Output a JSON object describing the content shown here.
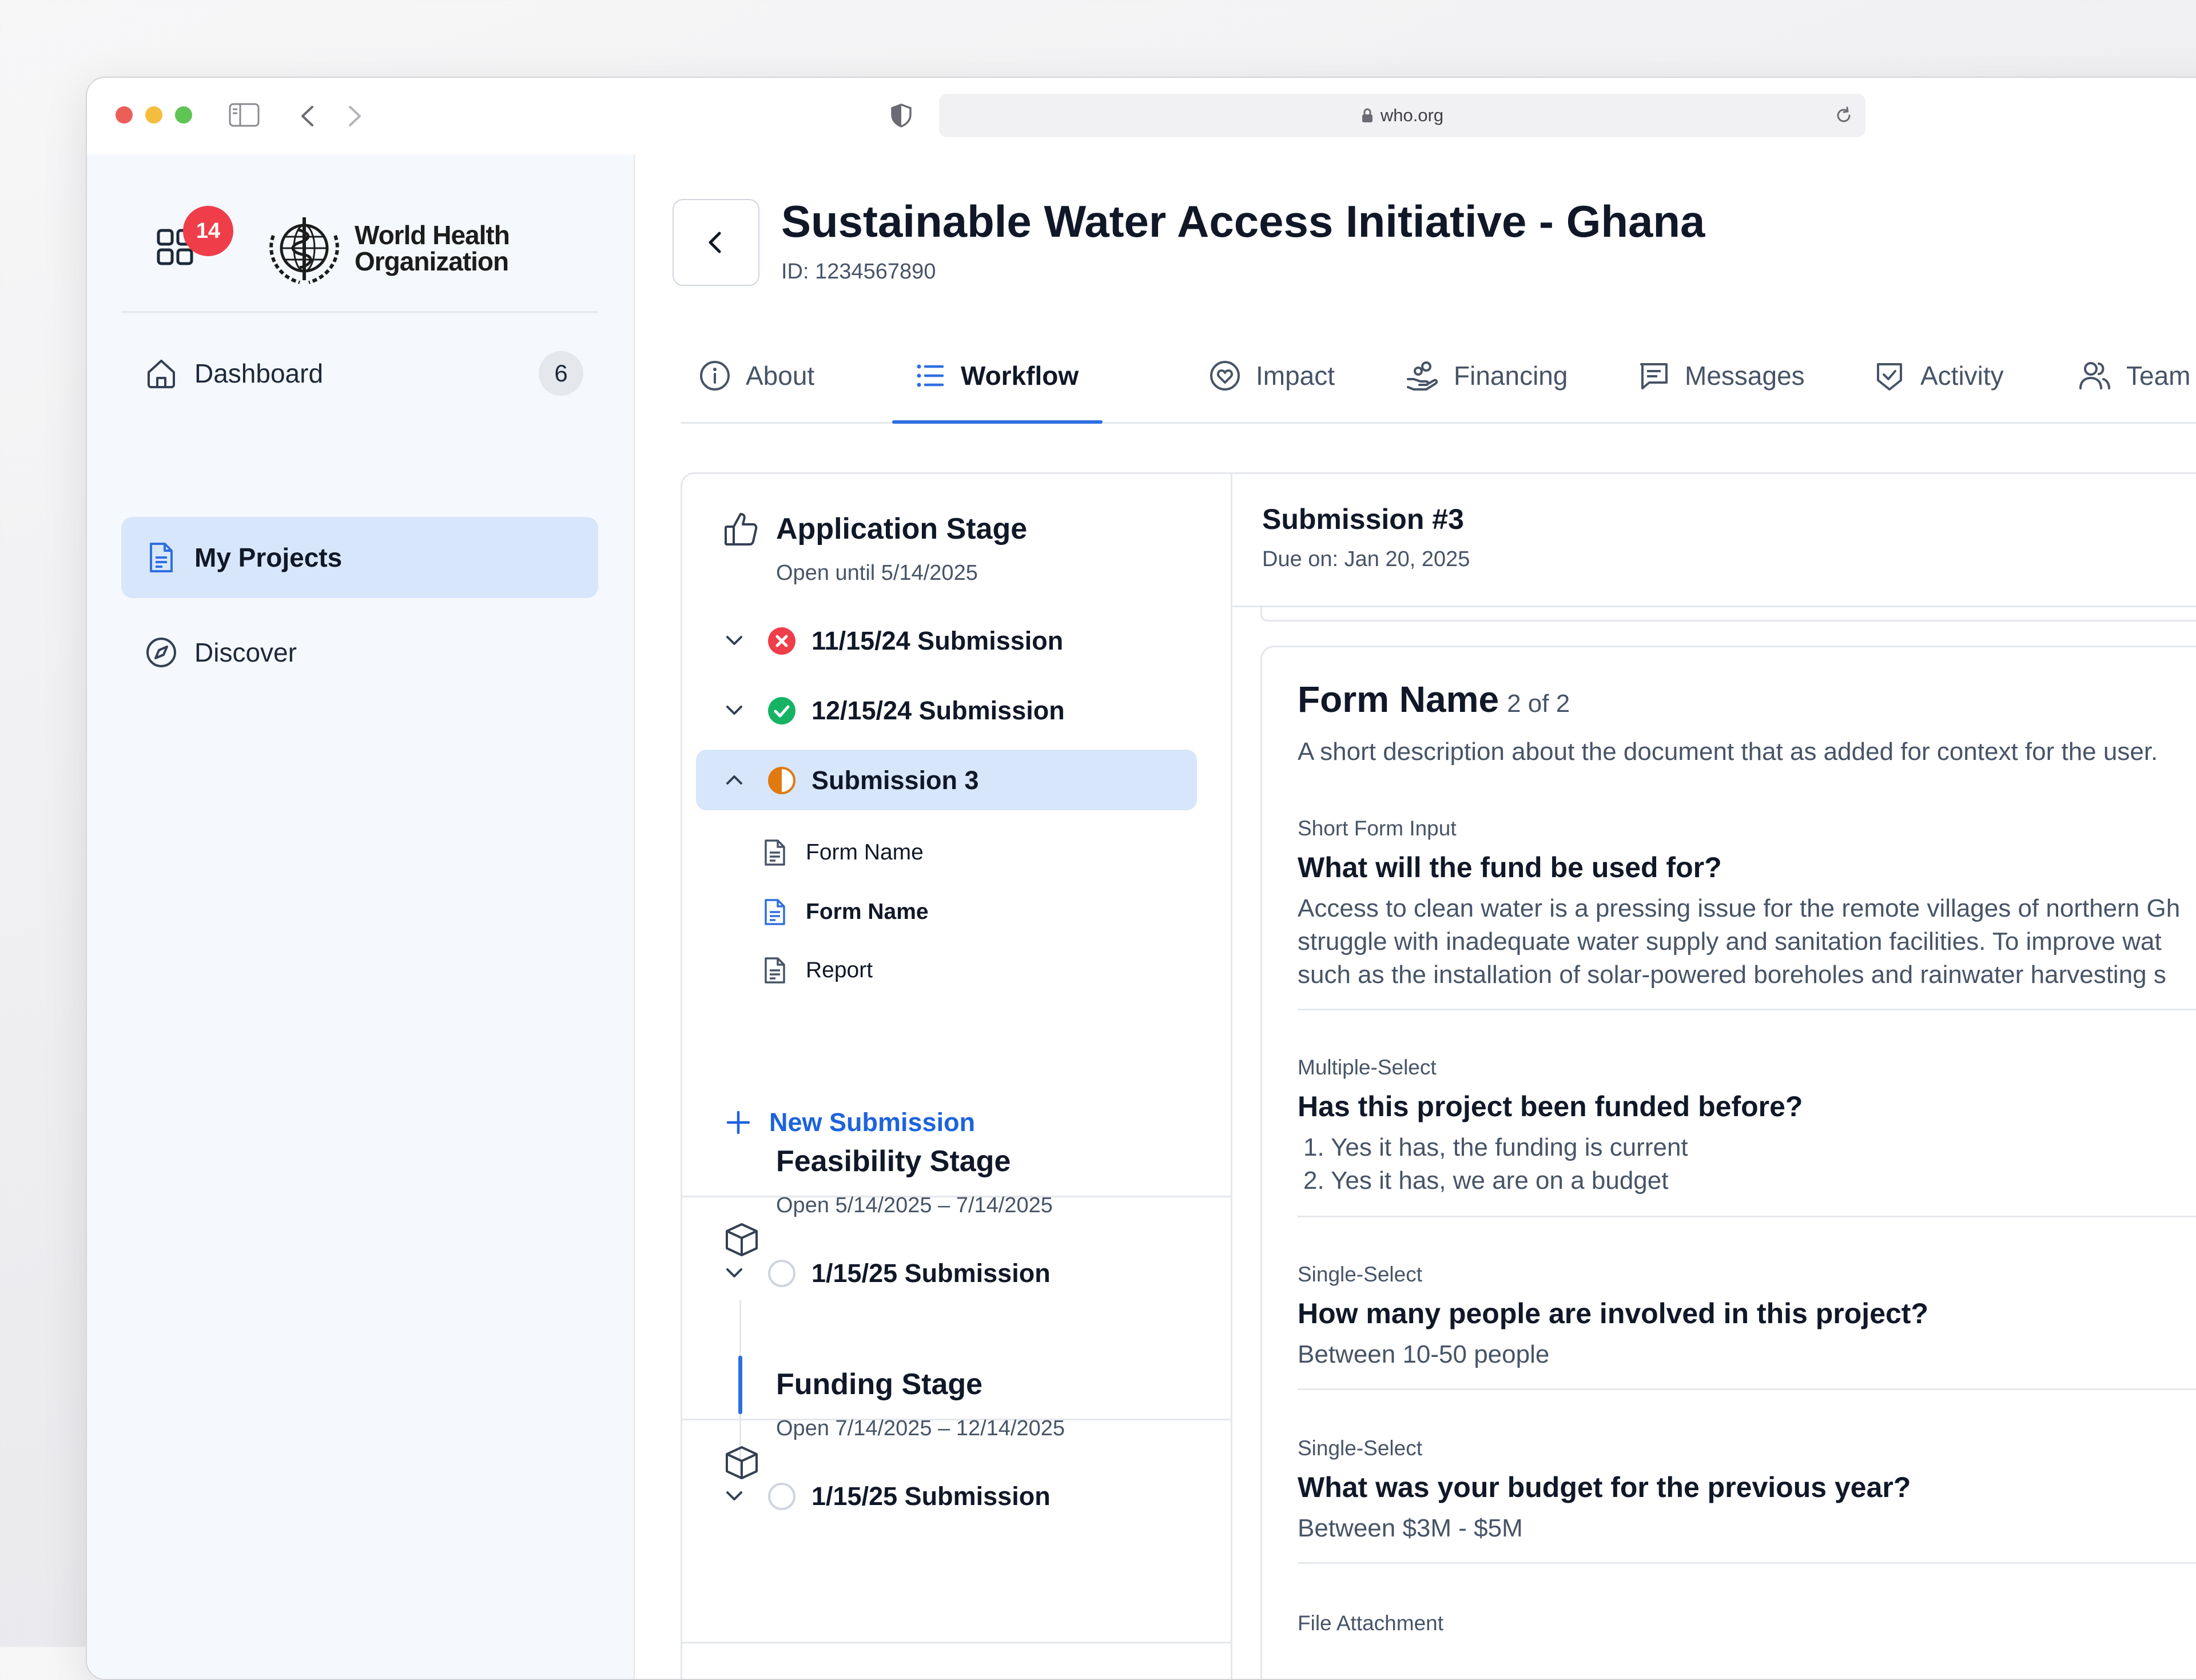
{
  "browser": {
    "url": "who.org"
  },
  "sidebar": {
    "notification_count": "14",
    "logo_line1": "World Health",
    "logo_line2": "Organization",
    "items": [
      {
        "label": "Dashboard",
        "badge": "6",
        "icon": "home-icon"
      },
      {
        "label": "My Projects",
        "icon": "document-icon"
      },
      {
        "label": "Discover",
        "icon": "compass-icon"
      }
    ]
  },
  "project": {
    "title": "Sustainable Water Access Initiative - Ghana",
    "id_label": "ID: 1234567890"
  },
  "tabs": [
    {
      "label": "About",
      "icon": "info-icon"
    },
    {
      "label": "Workflow",
      "icon": "list-icon"
    },
    {
      "label": "Impact",
      "icon": "heart-circle-icon"
    },
    {
      "label": "Financing",
      "icon": "hand-coins-icon"
    },
    {
      "label": "Messages",
      "icon": "message-icon"
    },
    {
      "label": "Activity",
      "icon": "shield-check-icon"
    },
    {
      "label": "Team",
      "icon": "users-icon"
    }
  ],
  "stages": {
    "application": {
      "title": "Application Stage",
      "subtitle": "Open until 5/14/2025",
      "submissions": [
        {
          "label": "11/15/24 Submission",
          "status": "rejected"
        },
        {
          "label": "12/15/24 Submission",
          "status": "approved"
        },
        {
          "label": "Submission 3",
          "status": "in-progress"
        }
      ],
      "forms": [
        {
          "label": "Form Name"
        },
        {
          "label": "Form Name"
        },
        {
          "label": "Report"
        }
      ],
      "new_submission": "New Submission"
    },
    "feasibility": {
      "title": "Feasibility Stage",
      "subtitle": "Open 5/14/2025 – 7/14/2025",
      "submission": "1/15/25 Submission"
    },
    "funding": {
      "title": "Funding Stage",
      "subtitle": "Open 7/14/2025 – 12/14/2025",
      "submission": "1/15/25 Submission"
    }
  },
  "submission": {
    "title": "Submission #3",
    "due": "Due on: Jan 20, 2025"
  },
  "form": {
    "name": "Form Name",
    "position": "2 of 2",
    "description": "A short description about the document that as added for context for the user.",
    "questions": [
      {
        "type": "Short Form Input",
        "question": "What will the fund be used for?",
        "answer_lines": [
          "Access to clean water is a pressing issue for the remote villages of northern Gh",
          "struggle with inadequate water supply and sanitation facilities. To improve wat",
          "such as the installation of solar-powered boreholes and rainwater harvesting s"
        ]
      },
      {
        "type": "Multiple-Select",
        "question": "Has this project been funded before?",
        "options": [
          "1.  Yes it has, the funding is current",
          "2.  Yes it has, we are on a budget"
        ]
      },
      {
        "type": "Single-Select",
        "question": "How many people are involved in this project?",
        "answer": "Between 10-50 people"
      },
      {
        "type": "Single-Select",
        "question": "What was your budget for the previous year?",
        "answer": "Between $3M - $5M"
      },
      {
        "type": "File Attachment"
      }
    ]
  },
  "colors": {
    "accent": "#2f6fe0",
    "active_bg": "#d8e6fb",
    "notification": "#ef3e4a",
    "rejected": "#ef3e4a",
    "approved": "#16b364",
    "in_progress": "#e07a10"
  }
}
